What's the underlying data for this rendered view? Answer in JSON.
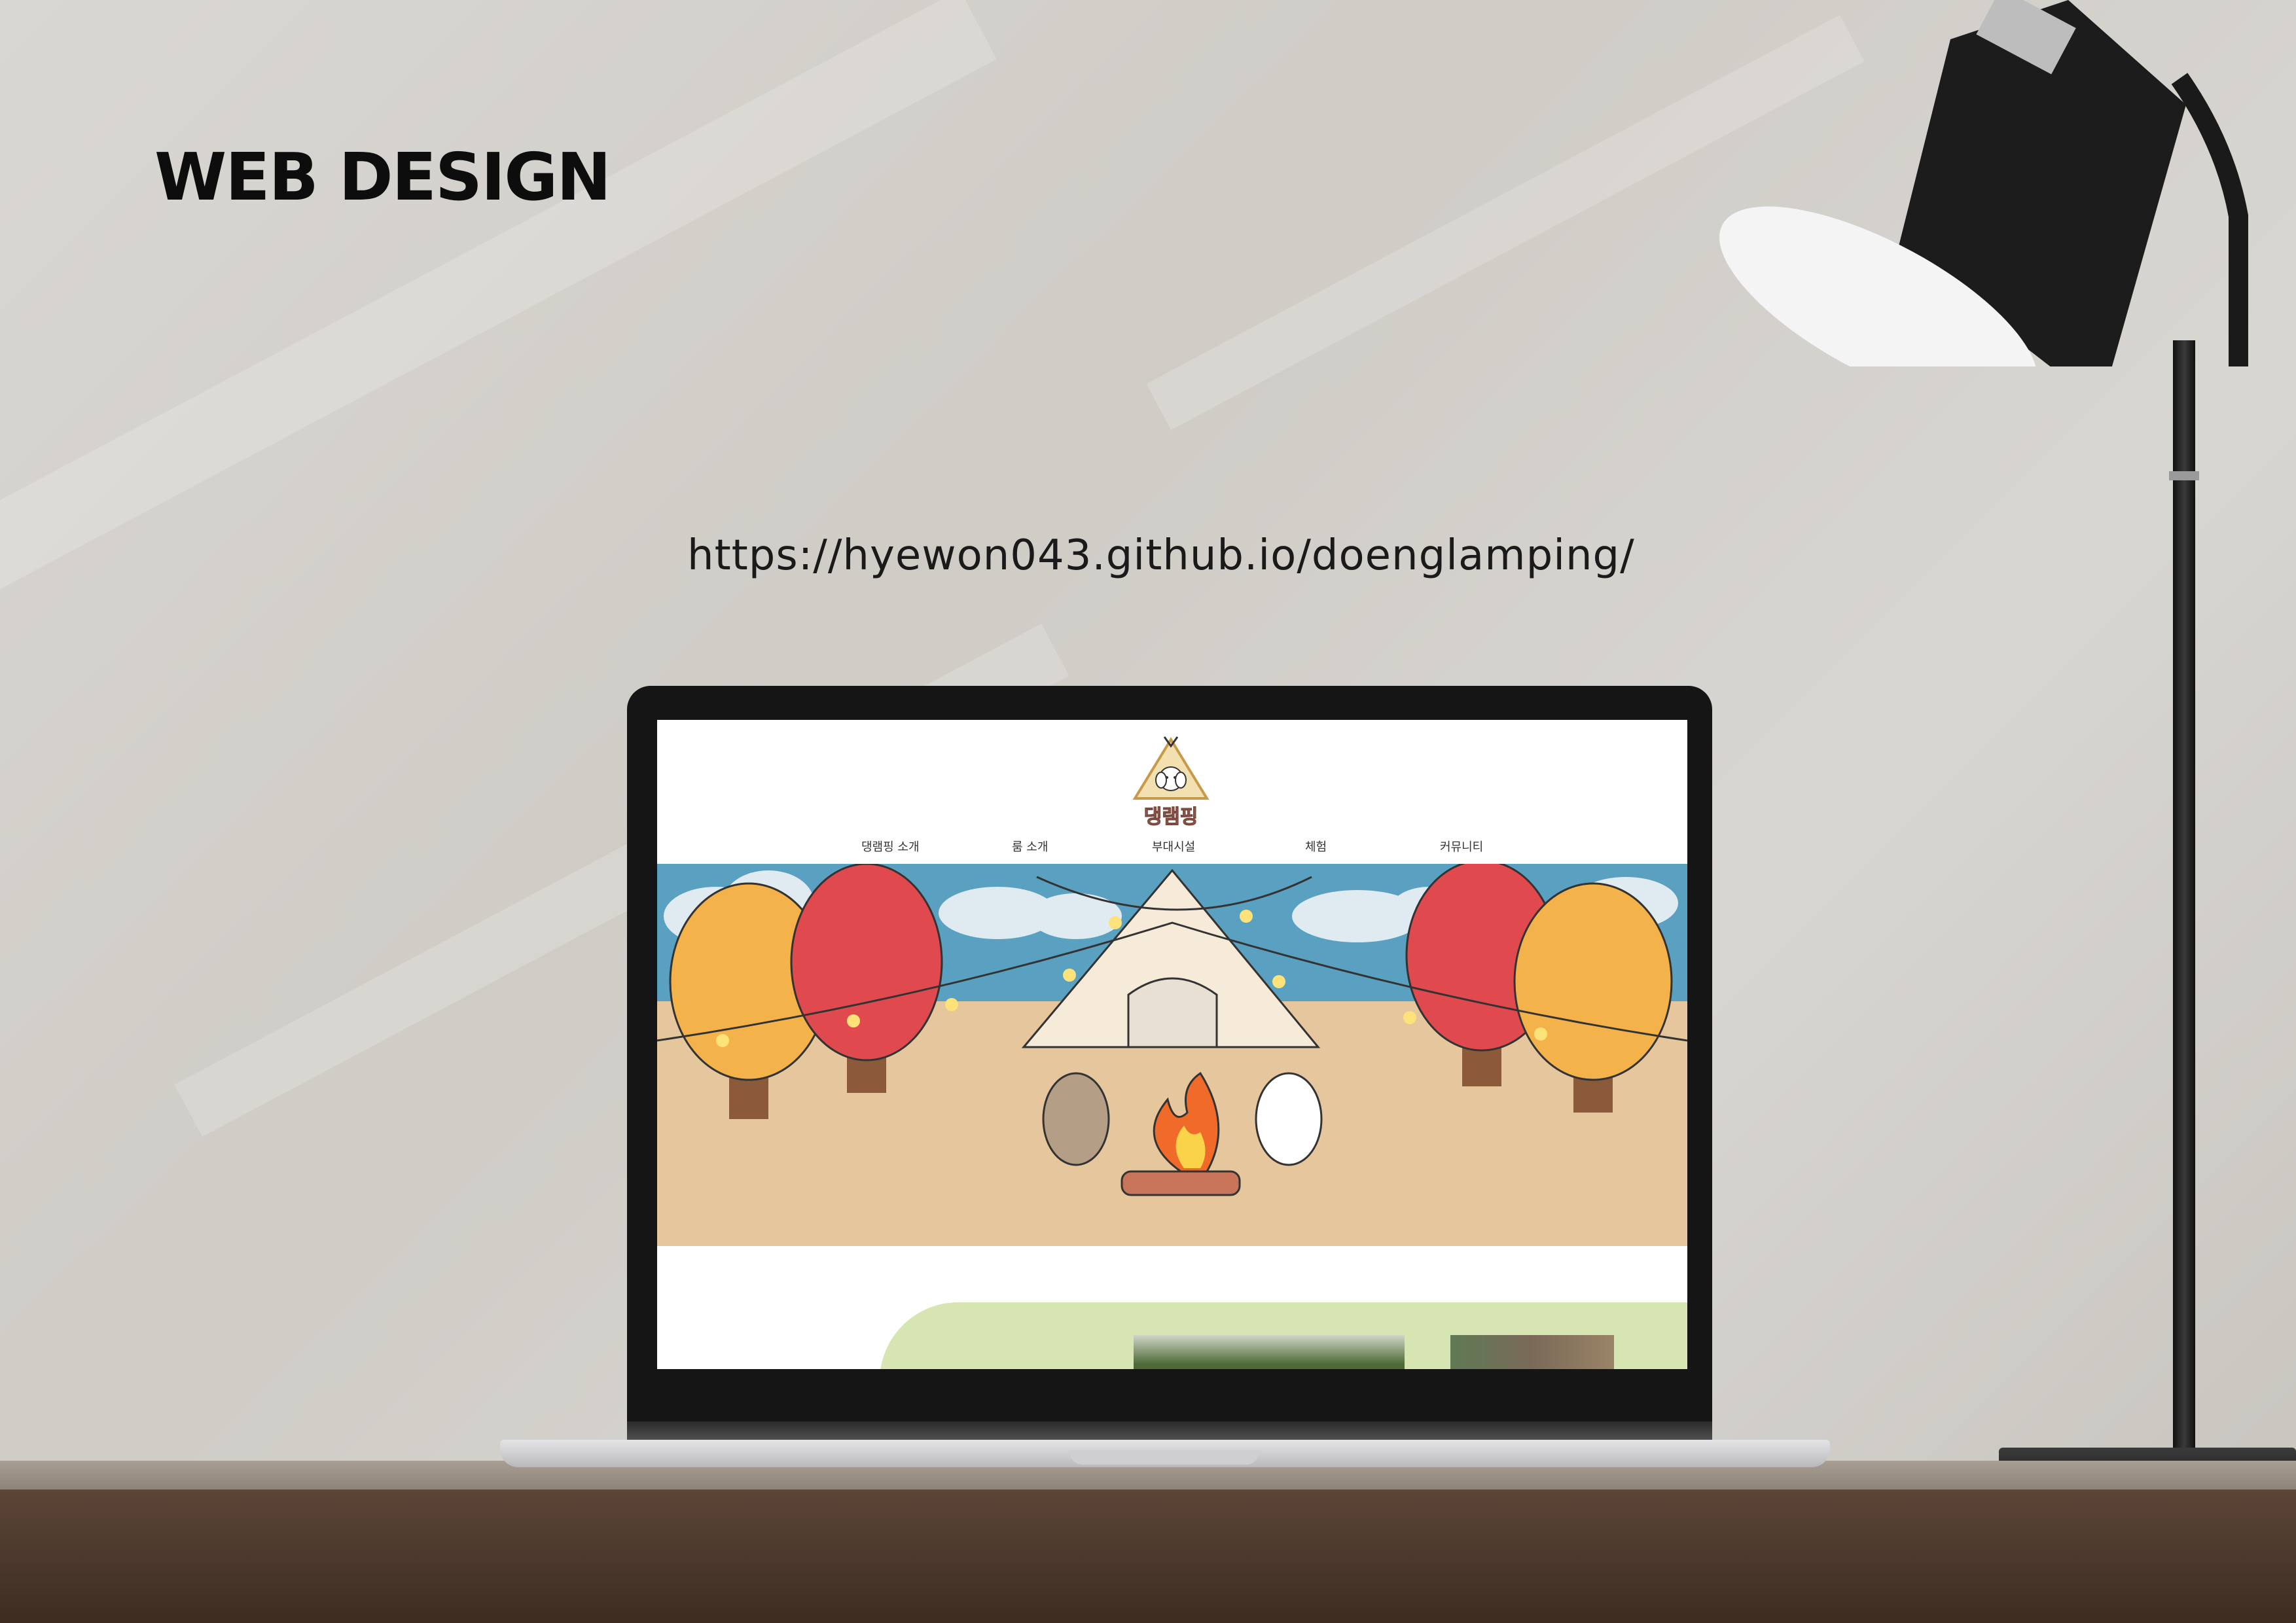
{
  "heading": "WEB DESIGN",
  "url": "https://hyewon043.github.io/doenglamping/",
  "website": {
    "logo_text": "댕램핑",
    "nav": [
      "댕램핑 소개",
      "룸 소개",
      "부대시설",
      "체험",
      "커뮤니티"
    ]
  },
  "colors": {
    "sky": "#5aa0c0",
    "ground": "#e6c69c",
    "tree_red": "#e04a4f",
    "tree_orange": "#f3b24a",
    "green_section": "#d7e5b3"
  }
}
